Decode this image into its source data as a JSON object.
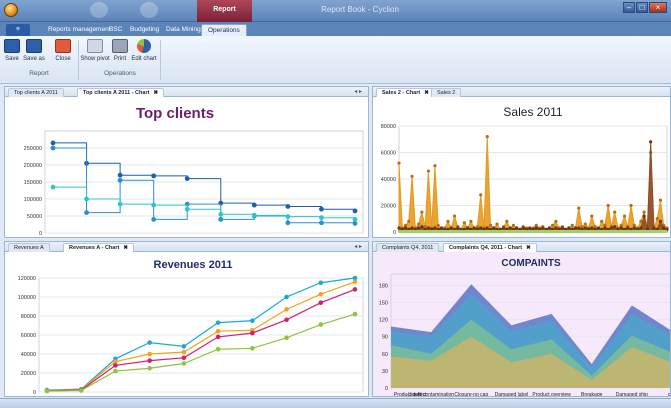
{
  "window": {
    "title": "Report Book - Cyclion",
    "context_tab": "Report"
  },
  "ribbon_tabs": [
    "Reports management",
    "BSC",
    "Budgeting",
    "Data Mining",
    "Operations"
  ],
  "ribbon": {
    "buttons": [
      "Save",
      "Save as",
      "Close",
      "Show pivot",
      "Print",
      "Edit chart"
    ],
    "groups": [
      "Report",
      "Operations"
    ]
  },
  "panes": {
    "top_left": {
      "tabs": [
        "Top clients A 2011",
        "Top clients A 2011 - Chart"
      ],
      "title": "Top clients"
    },
    "top_right": {
      "tabs": [
        "Sales 2 - Chart",
        "Sales 2"
      ],
      "title": "Sales 2011"
    },
    "bottom_left": {
      "tabs": [
        "Revenues A",
        "Revenues A - Chart"
      ],
      "title": "Revenues 2011"
    },
    "bottom_right": {
      "tabs": [
        "Complaints Q4, 2011",
        "Complaints Q4, 2011 - Chart"
      ],
      "title": "COMPAINTS"
    }
  },
  "colors": {
    "accent": "#5b84b8",
    "title_purple": "#6d1f6a",
    "title_navy": "#1e2d6b"
  },
  "chart_data": [
    {
      "type": "line",
      "title": "Top clients",
      "ylim": [
        0,
        300000
      ],
      "yticks": [
        0,
        50000,
        100000,
        150000,
        200000,
        250000
      ],
      "x": [
        1,
        2,
        3,
        4,
        5,
        6,
        7,
        8,
        9,
        10
      ],
      "series": [
        {
          "values": [
            265000,
            205000,
            170000,
            168000,
            160000,
            88000,
            82000,
            78000,
            70000,
            65000
          ],
          "color": "#1f5fa8"
        },
        {
          "values": [
            250000,
            60000,
            155000,
            40000,
            85000,
            40000,
            50000,
            30000,
            30000,
            28000
          ],
          "color": "#2a8fd0"
        },
        {
          "values": [
            135000,
            100000,
            85000,
            82000,
            70000,
            55000,
            52000,
            48000,
            45000,
            40000
          ],
          "color": "#2ec4c9"
        }
      ]
    },
    {
      "type": "area",
      "title": "Sales 2011",
      "ylim": [
        0,
        80000
      ],
      "yticks": [
        0,
        20000,
        40000,
        60000,
        80000
      ],
      "series": [
        {
          "values": [
            52000,
            3000,
            5000,
            8000,
            42000,
            3000,
            6000,
            15000,
            4000,
            46000,
            3000,
            50000,
            5000,
            2000,
            3000,
            8000,
            3000,
            12000,
            4000,
            2000,
            7000,
            3000,
            8000,
            3000,
            4000,
            28000,
            3000,
            72000,
            5000,
            3000,
            6000,
            2000,
            4000,
            8000,
            3000,
            5000,
            3000,
            2000,
            4000,
            3000,
            2000,
            3000,
            5000,
            3000,
            4000,
            2000,
            3000,
            5000,
            8000,
            3000,
            4000,
            2000,
            3000,
            5000,
            3000,
            18000,
            4000,
            6000,
            3000,
            12000,
            4000,
            2000,
            8000,
            5000,
            20000,
            4000,
            15000,
            3000,
            5000,
            12000,
            4000,
            20000,
            5000,
            3000,
            8000,
            15000,
            4000,
            60000,
            3000,
            10000,
            24000,
            5000,
            3000
          ],
          "color": "#e69a1e"
        },
        {
          "values": [
            3000,
            2000,
            3000,
            2000,
            3000,
            2000,
            3000,
            4000,
            2000,
            3000,
            2000,
            3000,
            2000,
            3000,
            2000,
            2000,
            3000,
            2000,
            3000,
            2000,
            2000,
            3000,
            2000,
            3000,
            2000,
            3000,
            2000,
            3000,
            2000,
            3000,
            2000,
            2000,
            3000,
            2000,
            3000,
            2000,
            3000,
            2000,
            3000,
            2000,
            3000,
            2000,
            3000,
            2000,
            3000,
            2000,
            3000,
            2000,
            3000,
            2000,
            3000,
            2000,
            3000,
            2000,
            3000,
            3000,
            2000,
            3000,
            2000,
            3000,
            2000,
            3000,
            2000,
            3000,
            2000,
            3000,
            4000,
            2000,
            3000,
            2000,
            3000,
            2000,
            3000,
            2000,
            3000,
            12000,
            2000,
            68000,
            3000,
            2000,
            8000,
            3000,
            2000
          ],
          "color": "#8a4a2a"
        }
      ]
    },
    {
      "type": "line",
      "title": "Revenues 2011",
      "ylim": [
        0,
        120000
      ],
      "yticks": [
        0,
        20000,
        40000,
        60000,
        80000,
        100000,
        120000
      ],
      "x": [
        1,
        2,
        3,
        4,
        5,
        6,
        7,
        8,
        9,
        10
      ],
      "series": [
        {
          "values": [
            2000,
            3000,
            35000,
            52000,
            48000,
            73000,
            75000,
            100000,
            115000,
            130000
          ],
          "color": "#18a9d8"
        },
        {
          "values": [
            1500,
            2500,
            32000,
            40000,
            42000,
            64000,
            65000,
            87000,
            103000,
            116000
          ],
          "color": "#f2a31c"
        },
        {
          "values": [
            1200,
            2000,
            28000,
            33000,
            36000,
            58000,
            62000,
            76000,
            94000,
            108000
          ],
          "color": "#d81e6a"
        },
        {
          "values": [
            1000,
            1500,
            22000,
            25000,
            30000,
            45000,
            46000,
            57000,
            71000,
            82000
          ],
          "color": "#8cc63e"
        }
      ]
    },
    {
      "type": "area",
      "title": "COMPAINTS",
      "ylim": [
        0,
        200
      ],
      "yticks": [
        0,
        30,
        60,
        90,
        120,
        150,
        180
      ],
      "categories": [
        "Product defect",
        "Liquid contamination",
        "Closure-no cap",
        "Damaged label",
        "Product overview",
        "Breakage",
        "Damaged ship",
        "ot"
      ],
      "series": [
        {
          "values": [
            108,
            98,
            182,
            110,
            130,
            42,
            145,
            100
          ],
          "color": "#5b74c8"
        },
        {
          "values": [
            100,
            90,
            165,
            100,
            118,
            36,
            130,
            92
          ],
          "color": "#4ba3c9"
        },
        {
          "values": [
            75,
            60,
            120,
            68,
            85,
            22,
            92,
            62
          ],
          "color": "#7bbd9a"
        },
        {
          "values": [
            55,
            48,
            90,
            45,
            60,
            14,
            72,
            45
          ],
          "color": "#c9b56a"
        }
      ]
    }
  ]
}
